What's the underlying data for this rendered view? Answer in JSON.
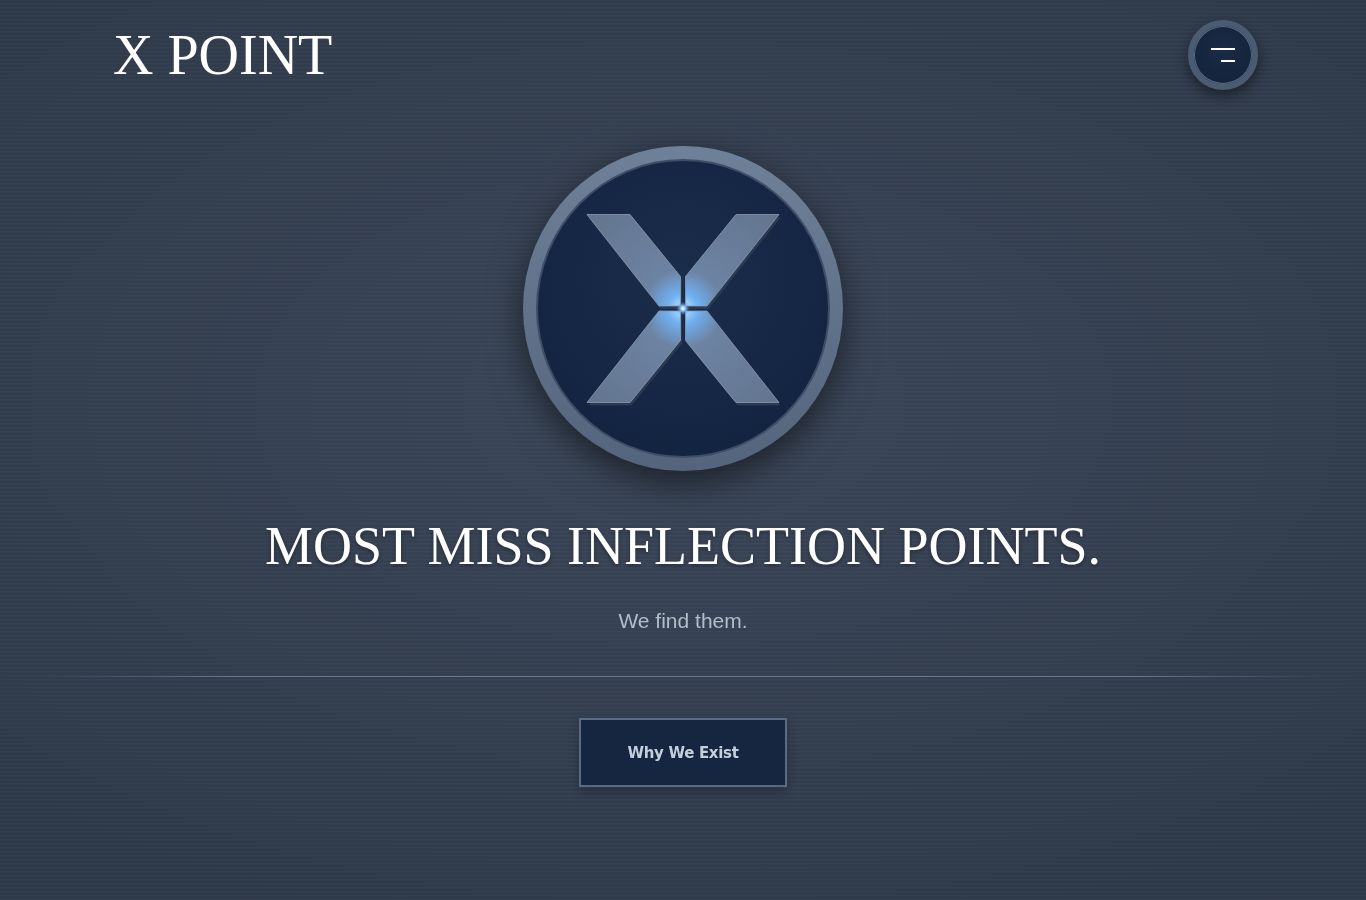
{
  "header": {
    "logo": "X POINT"
  },
  "hero": {
    "headline": "MOST MISS INFLECTION POINTS.",
    "subheadline": "We find them.",
    "button": "Why We Exist"
  }
}
